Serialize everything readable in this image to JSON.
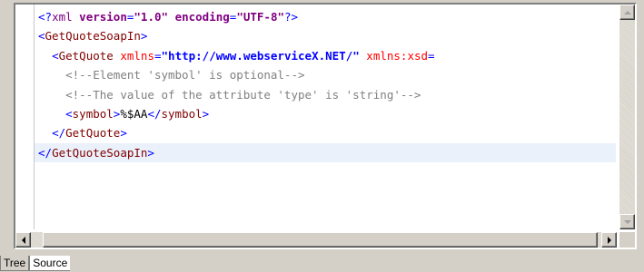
{
  "editor": {
    "lines": [
      {
        "current": false,
        "tokens": [
          {
            "t": "<?",
            "c": "punct"
          },
          {
            "t": "xml",
            "c": "pi-name"
          },
          {
            "t": " ",
            "c": "text"
          },
          {
            "t": "version",
            "c": "pi-attr"
          },
          {
            "t": "=",
            "c": "punct"
          },
          {
            "t": "\"1.0\"",
            "c": "pi-val"
          },
          {
            "t": " ",
            "c": "text"
          },
          {
            "t": "encoding",
            "c": "pi-attr"
          },
          {
            "t": "=",
            "c": "punct"
          },
          {
            "t": "\"UTF-8\"",
            "c": "pi-val"
          },
          {
            "t": "?>",
            "c": "punct"
          }
        ]
      },
      {
        "current": false,
        "tokens": [
          {
            "t": "<",
            "c": "punct"
          },
          {
            "t": "GetQuoteSoapIn",
            "c": "tag"
          },
          {
            "t": ">",
            "c": "punct"
          }
        ]
      },
      {
        "current": false,
        "tokens": [
          {
            "t": "  ",
            "c": "text"
          },
          {
            "t": "<",
            "c": "punct"
          },
          {
            "t": "GetQuote",
            "c": "tag"
          },
          {
            "t": " ",
            "c": "text"
          },
          {
            "t": "xmlns",
            "c": "attr"
          },
          {
            "t": "=",
            "c": "punct"
          },
          {
            "t": "\"http://www.webserviceX.NET/\"",
            "c": "val"
          },
          {
            "t": " ",
            "c": "text"
          },
          {
            "t": "xmlns:xsd",
            "c": "attr"
          },
          {
            "t": "=",
            "c": "punct"
          }
        ]
      },
      {
        "current": false,
        "tokens": [
          {
            "t": "    ",
            "c": "text"
          },
          {
            "t": "<!--Element 'symbol' is optional-->",
            "c": "comment"
          }
        ]
      },
      {
        "current": false,
        "tokens": [
          {
            "t": "    ",
            "c": "text"
          },
          {
            "t": "<!--The value of the attribute 'type' is 'string'-->",
            "c": "comment"
          }
        ]
      },
      {
        "current": false,
        "tokens": [
          {
            "t": "    ",
            "c": "text"
          },
          {
            "t": "<",
            "c": "punct"
          },
          {
            "t": "symbol",
            "c": "tag"
          },
          {
            "t": ">",
            "c": "punct"
          },
          {
            "t": "%$AA",
            "c": "text"
          },
          {
            "t": "</",
            "c": "punct"
          },
          {
            "t": "symbol",
            "c": "tag"
          },
          {
            "t": ">",
            "c": "punct"
          }
        ]
      },
      {
        "current": false,
        "tokens": [
          {
            "t": "  ",
            "c": "text"
          },
          {
            "t": "</",
            "c": "punct"
          },
          {
            "t": "GetQuote",
            "c": "tag"
          },
          {
            "t": ">",
            "c": "punct"
          }
        ]
      },
      {
        "current": true,
        "tokens": [
          {
            "t": "</",
            "c": "punct"
          },
          {
            "t": "GetQuoteSoapIn",
            "c": "tag"
          },
          {
            "t": ">",
            "c": "punct"
          }
        ]
      },
      {
        "current": false,
        "tokens": []
      },
      {
        "current": false,
        "tokens": []
      },
      {
        "current": false,
        "tokens": []
      }
    ]
  },
  "scrollbars": {
    "vertical": {
      "up_icon": "arrow-up-icon",
      "down_icon": "arrow-down-icon"
    },
    "horizontal": {
      "left_icon": "arrow-left-icon",
      "right_icon": "arrow-right-icon"
    }
  },
  "tabs": [
    {
      "label": "Tree",
      "active": false
    },
    {
      "label": "Source",
      "active": true
    }
  ]
}
